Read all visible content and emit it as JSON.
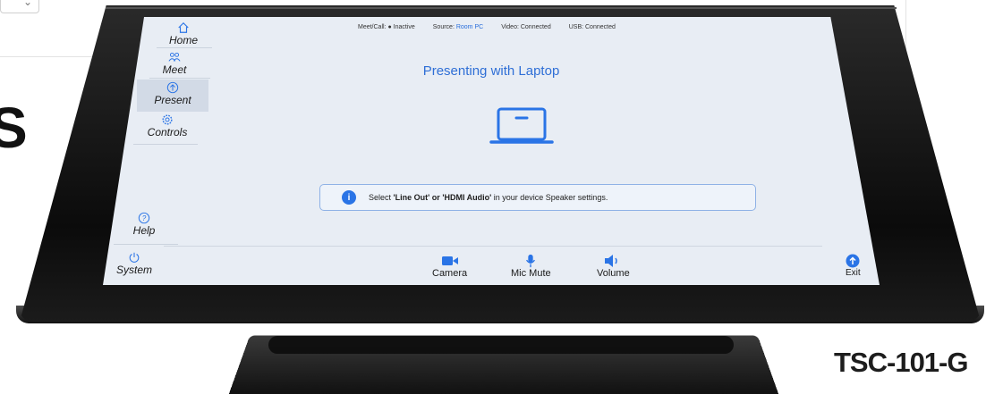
{
  "status_bar": {
    "meet_call": "Meet/Call: ● Inactive",
    "source_label": "Source:",
    "source_value": "Room PC",
    "video": "Video: Connected",
    "usb": "USB: Connected"
  },
  "sidebar": {
    "items": [
      {
        "label": "Home",
        "icon": "home-icon"
      },
      {
        "label": "Meet",
        "icon": "people-icon"
      },
      {
        "label": "Present",
        "icon": "arrow-up-circle-icon",
        "active": true
      },
      {
        "label": "Controls",
        "icon": "gear-icon"
      },
      {
        "label": "Help",
        "icon": "question-circle-icon"
      },
      {
        "label": "System",
        "icon": "power-icon"
      }
    ]
  },
  "main": {
    "title": "Presenting with Laptop",
    "info": {
      "prefix": "Select ",
      "option1": "'Line Out'",
      "or": " or ",
      "option2": "'HDMI Audio'",
      "suffix": " in your device Speaker settings."
    }
  },
  "toolbar": {
    "camera": "Camera",
    "mic_mute": "Mic Mute",
    "volume": "Volume",
    "exit": "Exit"
  },
  "background": {
    "big_letter": "S",
    "model_text": "TSC-101-G"
  },
  "colors": {
    "accent": "#2a74e6",
    "screen_bg": "#e8edf4",
    "title_blue": "#2f6fd6"
  }
}
